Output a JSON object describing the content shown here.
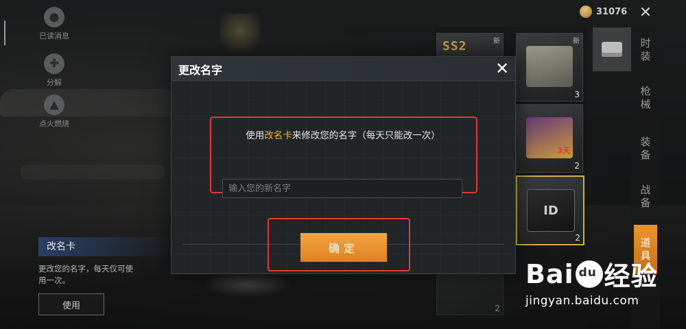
{
  "left_nav": {
    "items": [
      {
        "label": "已读消息",
        "icon": "avatar-icon"
      },
      {
        "label": "分解",
        "icon": "puzzle-icon"
      },
      {
        "label": "点火燃烧",
        "icon": "flame-icon"
      }
    ]
  },
  "item_info": {
    "title": "改名卡",
    "description": "更改您的名字，每天仅可使用一次。",
    "use_button": "使用"
  },
  "currency": {
    "amount": "31076",
    "icon": "coin-icon"
  },
  "inventory": {
    "slots": [
      {
        "badge": "新",
        "art_text": "SS2",
        "count": ""
      },
      {
        "badge": "新",
        "art_text": "",
        "count": "3"
      },
      {
        "badge": "",
        "art_text": "3天",
        "count": "2"
      },
      {
        "badge": "",
        "art_text": "",
        "count": "2"
      },
      {
        "badge": "",
        "art_text": "ID",
        "count": "2"
      }
    ]
  },
  "side_tabs": [
    "时装",
    "枪械",
    "装备",
    "战备",
    "道具"
  ],
  "dialog": {
    "title": "更改名字",
    "instruction_prefix": "使用",
    "instruction_highlight": "改名卡",
    "instruction_suffix": "来修改您的名字（每天只能改一次）",
    "input_placeholder": "输入您的新名字",
    "input_value": "",
    "confirm_label": "确定"
  },
  "watermark": {
    "brand_left": "Bai",
    "brand_right": "经验",
    "url": "jingyan.baidu.com"
  },
  "colors": {
    "accent_orange": "#e9962f",
    "highlight_gold": "#f0b53a",
    "annotation_red": "#e23a36",
    "dialog_bg": "#25282b"
  }
}
